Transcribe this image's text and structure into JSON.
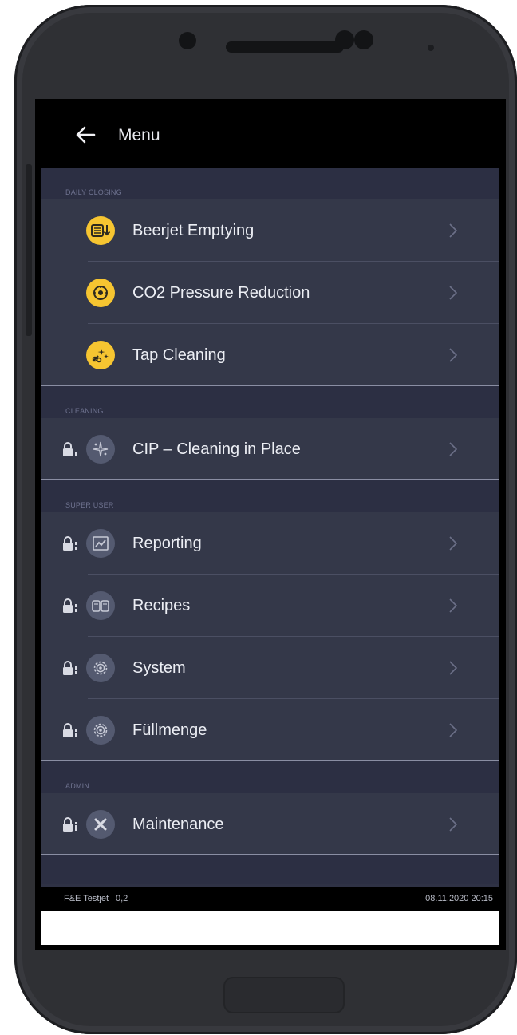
{
  "topbar": {
    "title": "Menu",
    "back_icon": "arrow-left-icon"
  },
  "sections": [
    {
      "header": "DAILY CLOSING",
      "items": [
        {
          "label": "Beerjet Emptying",
          "icon": "beerjet-empty-icon",
          "locked": false
        },
        {
          "label": "CO2 Pressure Reduction",
          "icon": "pressure-gauge-icon",
          "locked": false
        },
        {
          "label": "Tap Cleaning",
          "icon": "tap-cleaning-icon",
          "locked": false
        }
      ]
    },
    {
      "header": "CLEANING",
      "items": [
        {
          "label": "CIP – Cleaning in Place",
          "icon": "sparkle-icon",
          "locked": true
        }
      ]
    },
    {
      "header": "SUPER USER",
      "items": [
        {
          "label": "Reporting",
          "icon": "chart-icon",
          "locked": true
        },
        {
          "label": "Recipes",
          "icon": "recipes-icon",
          "locked": true
        },
        {
          "label": "System",
          "icon": "gear-icon",
          "locked": true
        },
        {
          "label": "Füllmenge",
          "icon": "gear-icon",
          "locked": true
        }
      ]
    },
    {
      "header": "ADMIN",
      "items": [
        {
          "label": "Maintenance",
          "icon": "tools-icon",
          "locked": true
        }
      ]
    }
  ],
  "status": {
    "left": "F&E Testjet  |  0,2",
    "right": "08.11.2020 20:15"
  },
  "colors": {
    "accent": "#f6c531",
    "surface": "#343849",
    "header": "#2c2f43"
  }
}
